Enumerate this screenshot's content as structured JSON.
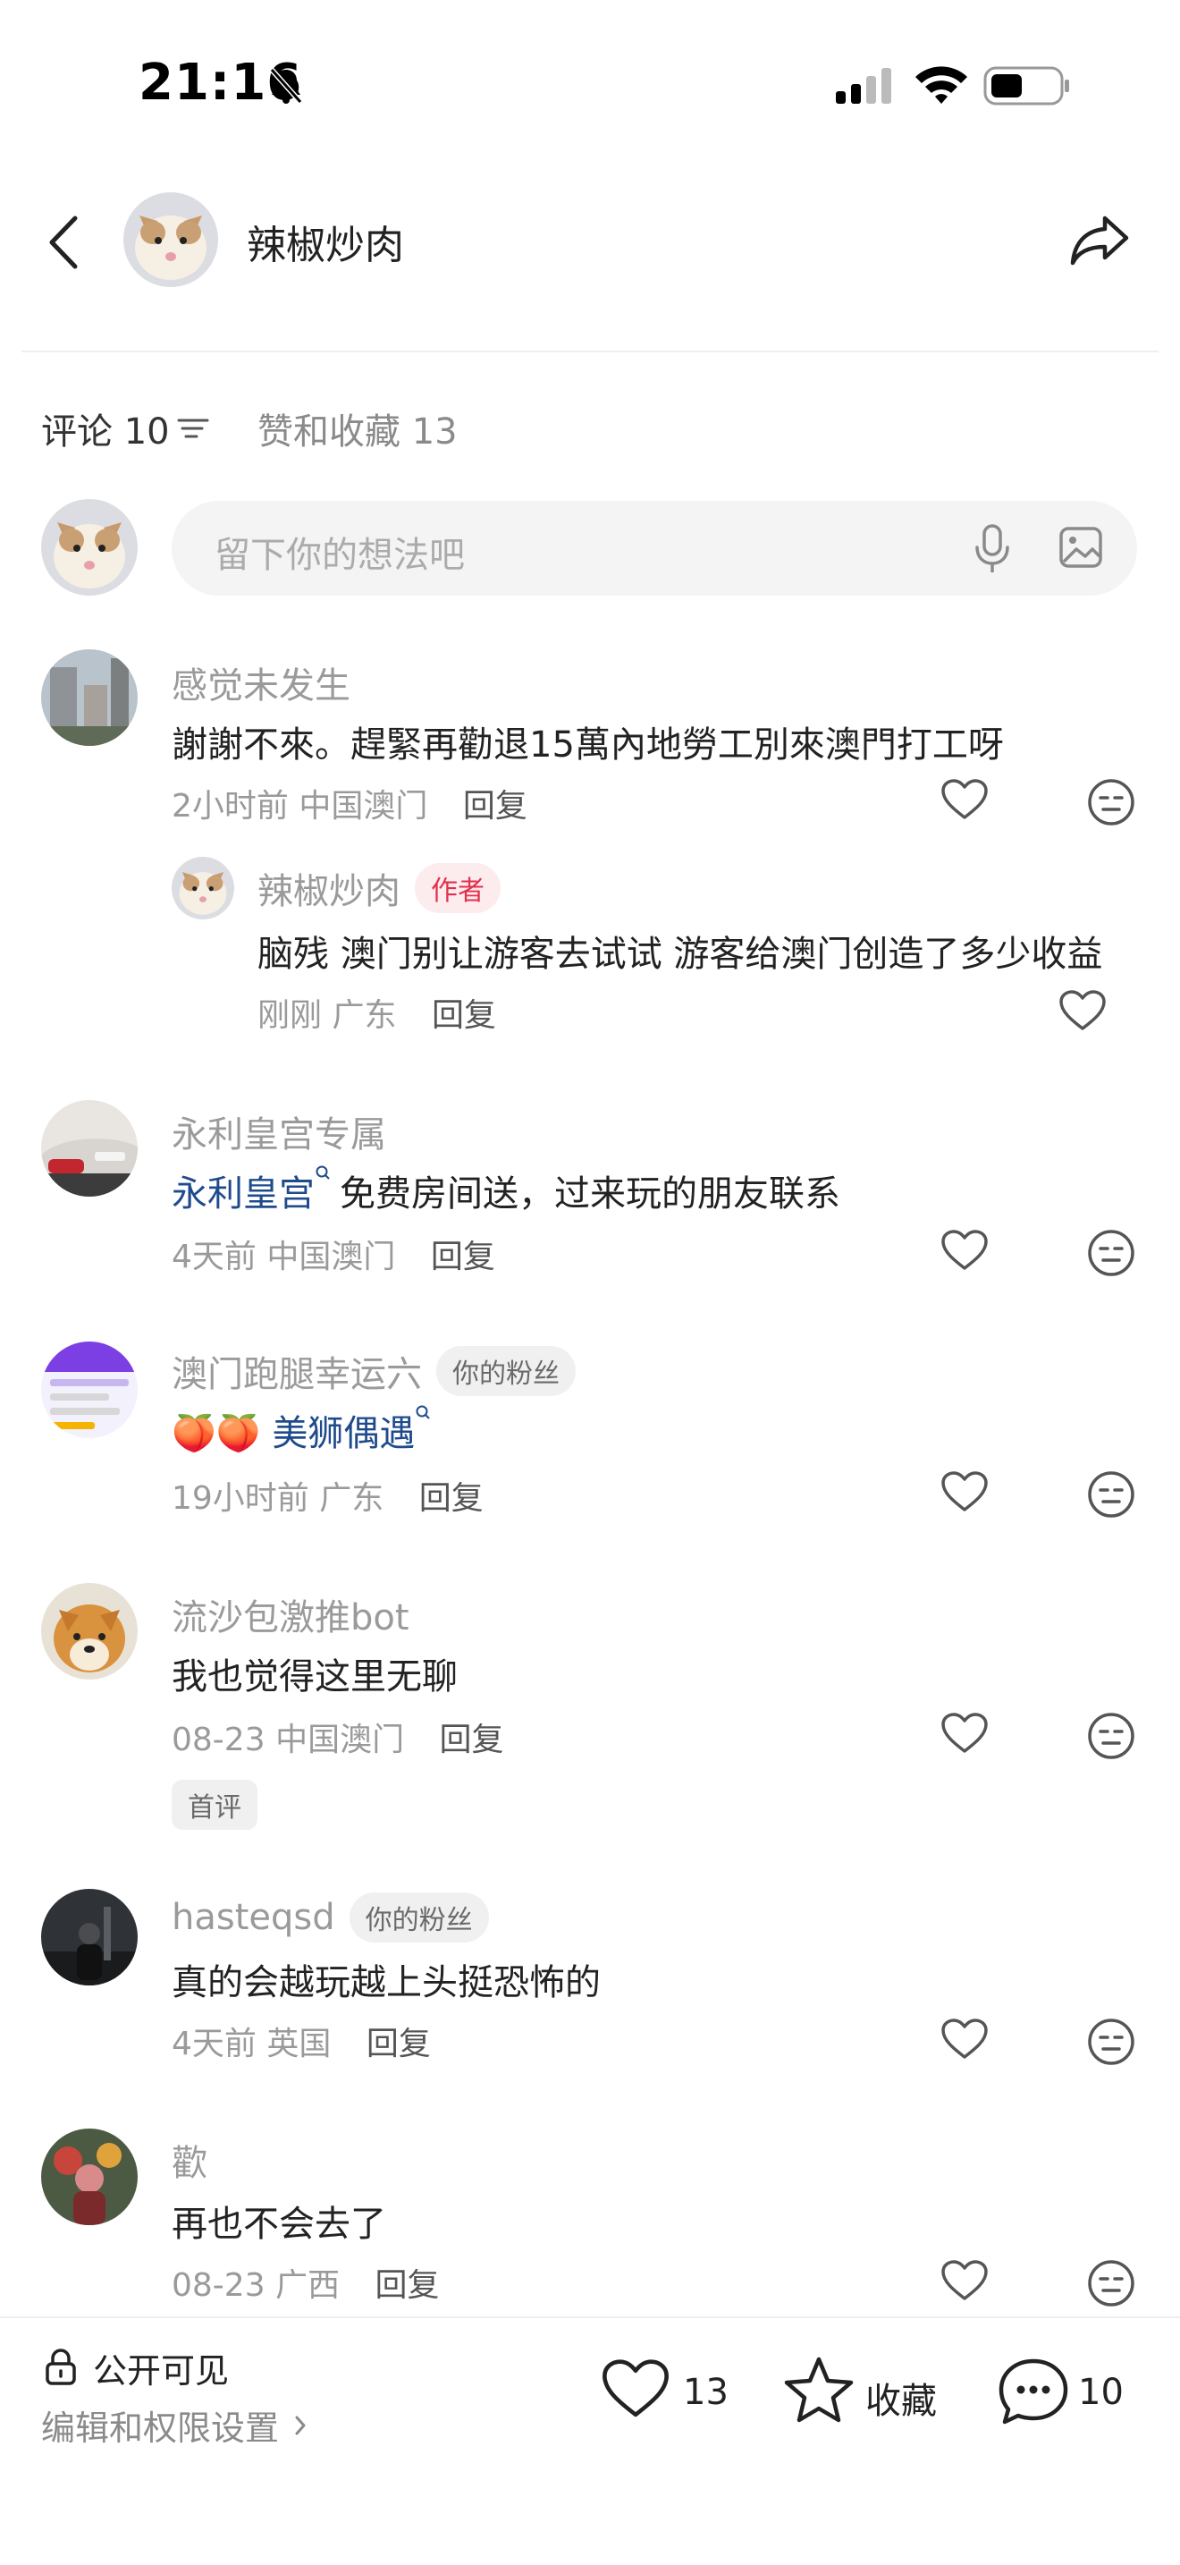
{
  "status_bar": {
    "time": "21:16",
    "icons": [
      "bell-slash-icon",
      "signal-icon",
      "wifi-icon",
      "battery-icon"
    ]
  },
  "header": {
    "title": "辣椒炒肉",
    "icons": [
      "back-icon",
      "share-icon"
    ]
  },
  "tabs": {
    "comments": "评论 10",
    "likes_favorites": "赞和收藏 13"
  },
  "comment_input": {
    "placeholder": "留下你的想法吧"
  },
  "comments": [
    {
      "name": "感觉未发生",
      "text": "謝謝不來。趕緊再勸退15萬內地勞工別來澳門打工呀",
      "time": "2小时前",
      "location": "中国澳门",
      "reply_label": "回复",
      "replies": [
        {
          "name": "辣椒炒肉",
          "badge": "作者",
          "text": "脑残 澳门别让游客去试试 游客给澳门创造了多少收益",
          "time": "刚刚",
          "location": "广东",
          "reply_label": "回复"
        }
      ]
    },
    {
      "name": "永利皇宫专属",
      "link": "永利皇宫",
      "text": "免费房间送，过来玩的朋友联系",
      "time": "4天前",
      "location": "中国澳门",
      "reply_label": "回复"
    },
    {
      "name": "澳门跑腿幸运六",
      "badge": "你的粉丝",
      "link": "美狮偶遇",
      "emoji": "🍑🍑",
      "time": "19小时前",
      "location": "广东",
      "reply_label": "回复"
    },
    {
      "name": "流沙包激推bot",
      "text": "我也觉得这里无聊",
      "time": "08-23",
      "location": "中国澳门",
      "reply_label": "回复",
      "tag": "首评"
    },
    {
      "name": "hasteqsd",
      "badge": "你的粉丝",
      "text": "真的会越玩越上头挺恐怖的",
      "time": "4天前",
      "location": "英国",
      "reply_label": "回复"
    },
    {
      "name": "歡",
      "text": "再也不会去了",
      "time": "08-23",
      "location": "广西",
      "reply_label": "回复"
    }
  ],
  "bottom_bar": {
    "visibility": "公开可见",
    "permission_link": "编辑和权限设置",
    "like_count": "13",
    "favorite_label": "收藏",
    "comment_count": "10"
  },
  "colors": {
    "accent_red": "#e3304a",
    "link_blue": "#1f4b8c",
    "gray_text": "#9a9a9a",
    "input_bg": "#f4f4f4"
  }
}
